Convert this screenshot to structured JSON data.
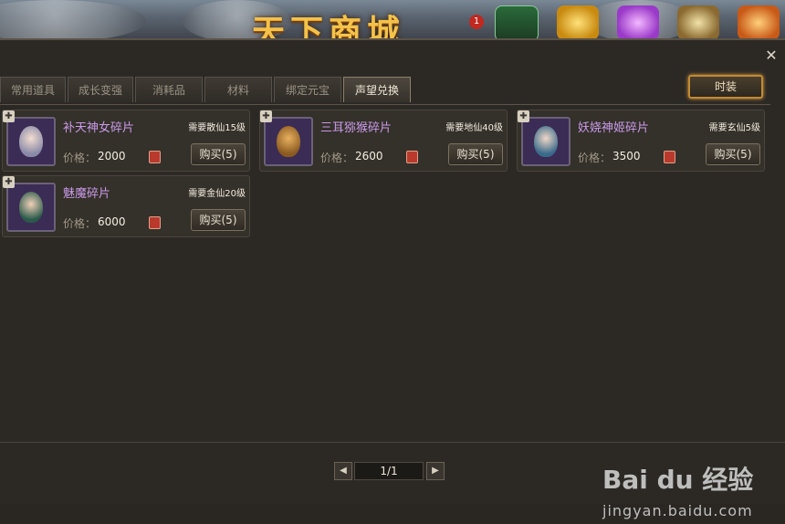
{
  "banner": {
    "title": "天下商城",
    "notice_count": "1",
    "icons": [
      "inn-icon",
      "gold-ingot-icon",
      "purple-gem-icon",
      "treasure-chest-icon",
      "gift-icon"
    ]
  },
  "tabs": [
    {
      "label": "常用道具",
      "active": false
    },
    {
      "label": "成长变强",
      "active": false
    },
    {
      "label": "消耗品",
      "active": false
    },
    {
      "label": "材料",
      "active": false
    },
    {
      "label": "绑定元宝",
      "active": false
    },
    {
      "label": "声望兑换",
      "active": true
    }
  ],
  "fashion_button": "时装",
  "items": [
    {
      "name": "补天神女碎片",
      "requirement": "需要散仙15级",
      "price_label": "价格：",
      "price": "2000",
      "buy_label": "购买(5)"
    },
    {
      "name": "三耳猕猴碎片",
      "requirement": "需要地仙40级",
      "price_label": "价格：",
      "price": "2600",
      "buy_label": "购买(5)"
    },
    {
      "name": "妖娆神姬碎片",
      "requirement": "需要玄仙5级",
      "price_label": "价格：",
      "price": "3500",
      "buy_label": "购买(5)"
    },
    {
      "name": "魅魔碎片",
      "requirement": "需要金仙20级",
      "price_label": "价格：",
      "price": "6000",
      "buy_label": "购买(5)"
    }
  ],
  "pager": {
    "page": "1/1"
  },
  "watermark": {
    "main": "Bai du 经验",
    "sub": "jingyan.baidu.com"
  },
  "colors": {
    "item_name": "#c99ae8",
    "accent_gold": "#c18a33"
  }
}
